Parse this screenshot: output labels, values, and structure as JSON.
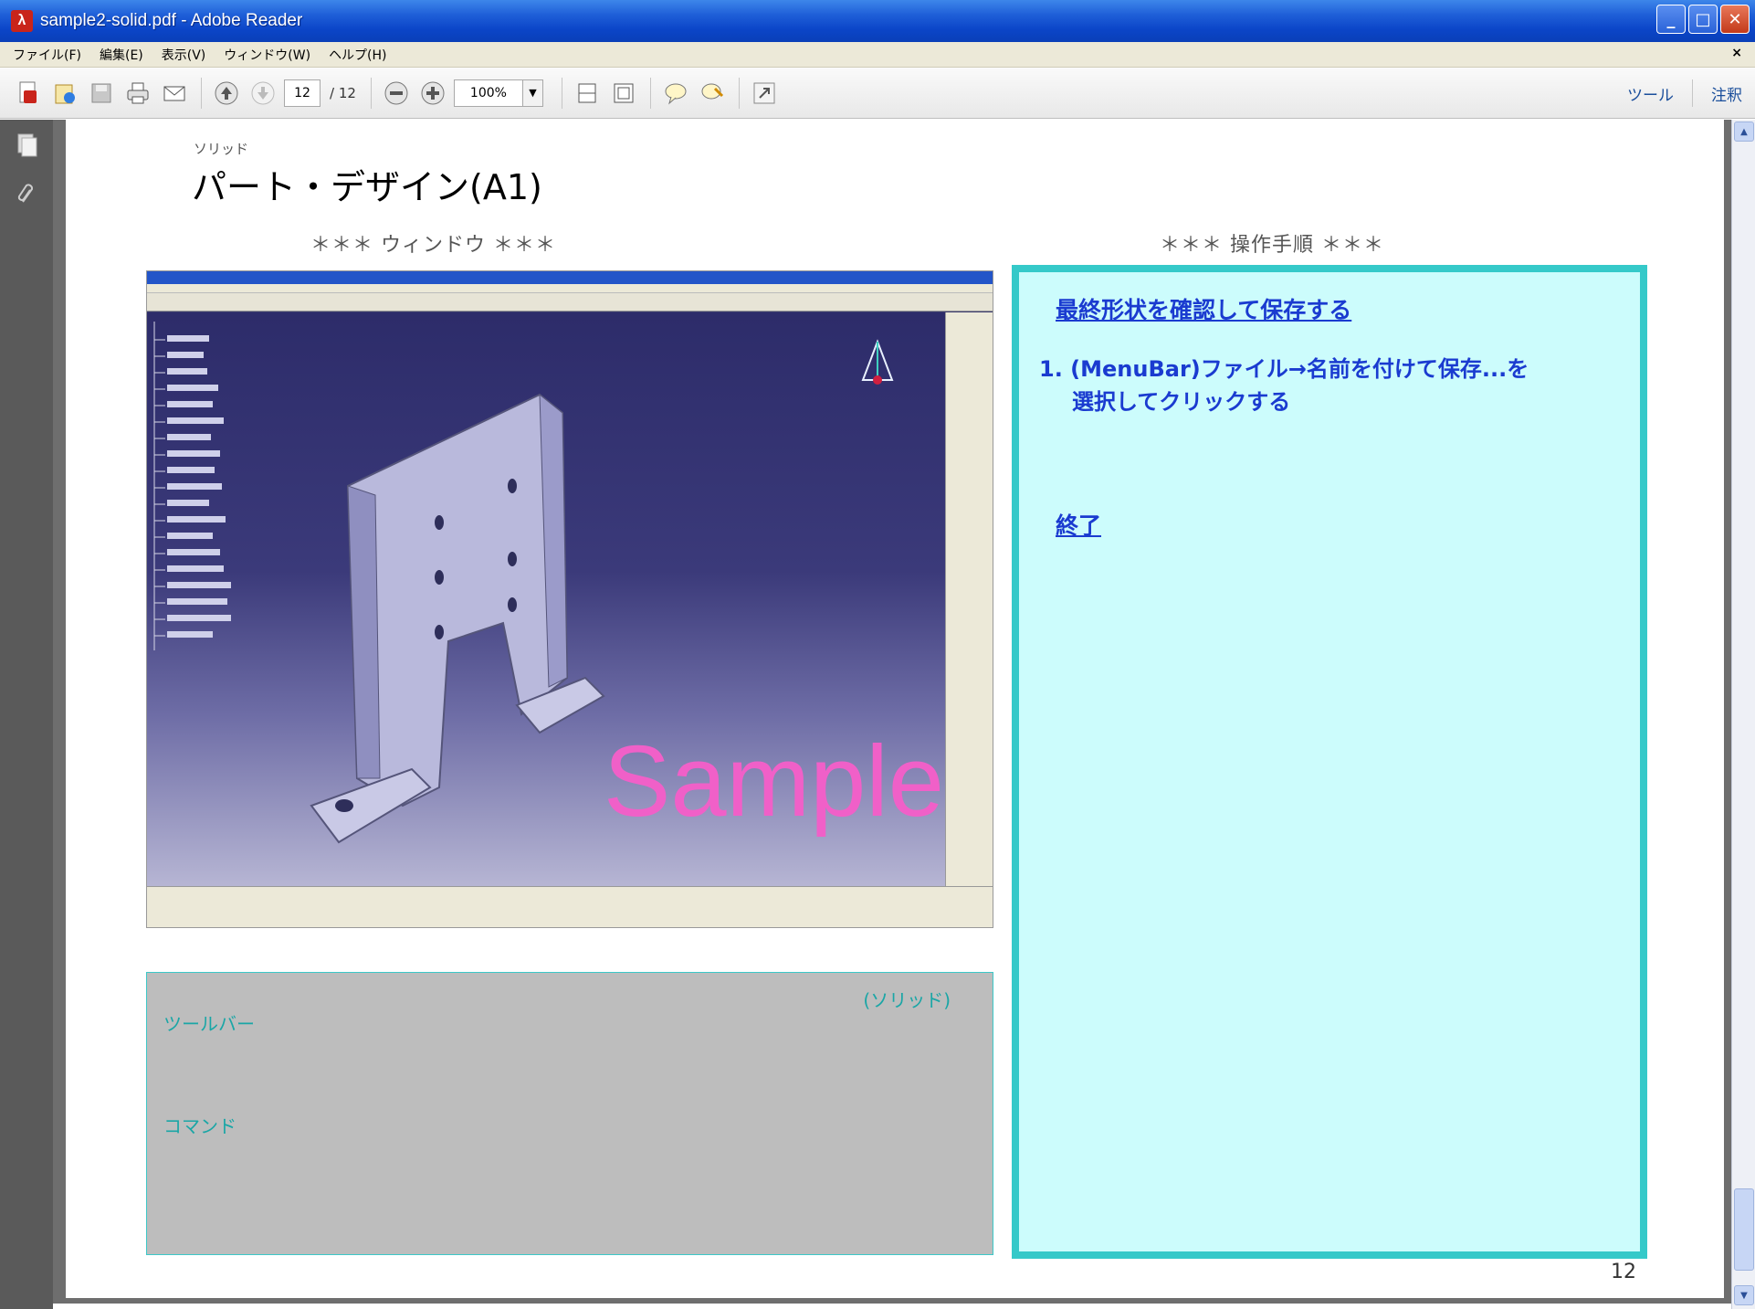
{
  "window": {
    "title": "sample2-solid.pdf - Adobe Reader"
  },
  "menubar": {
    "items": [
      "ファイル(F)",
      "編集(E)",
      "表示(V)",
      "ウィンドウ(W)",
      "ヘルプ(H)"
    ],
    "close_label": "×"
  },
  "toolbar": {
    "page_current": "12",
    "page_total": "/ 12",
    "zoom": "100%",
    "tools_label": "ツール",
    "comment_label": "注釈"
  },
  "page": {
    "category": "ソリッド",
    "title": "パート・デザイン(A1)",
    "section_window": "＊＊＊ ウィンドウ ＊＊＊",
    "section_procedure": "＊＊＊ 操作手順 ＊＊＊",
    "watermark": "Sample",
    "info_box": {
      "solid_label": "(ソリッド)",
      "toolbar_label": "ツールバー",
      "command_label": "コマンド"
    },
    "procedure": {
      "heading_link": "最終形状を確認して保存する",
      "step1_line1": "1. (MenuBar)ファイル→名前を付けて保存...を",
      "step1_line2": "選択してクリックする",
      "end_link": "終了"
    },
    "page_number": "12"
  },
  "colors": {
    "titlebar": "#0b45c8",
    "panel_bg": "#ccfcfc",
    "panel_border": "#35c9c9",
    "link": "#1a3bd0",
    "info_text": "#1aa6a6",
    "watermark": "#f060c8"
  }
}
